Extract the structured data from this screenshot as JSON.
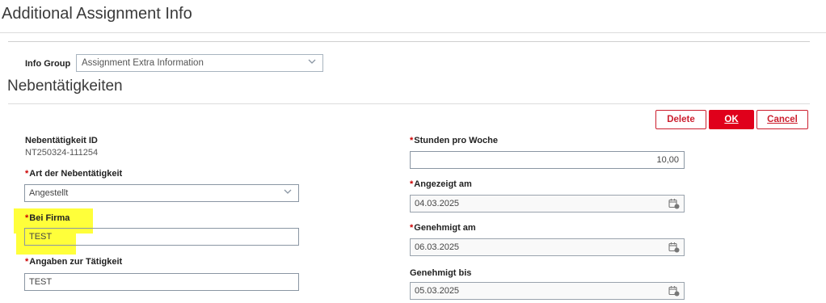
{
  "page": {
    "title": "Additional Assignment Info"
  },
  "info_group": {
    "label": "Info Group",
    "value": "Assignment Extra Information"
  },
  "section": {
    "title": "Nebentätigkeiten"
  },
  "buttons": {
    "delete": "Delete",
    "ok": "OK",
    "cancel": "Cancel"
  },
  "left": {
    "id_label": "Nebentätigkeit ID",
    "id_value": "NT250324-111254",
    "art_label": "Art der Nebentätigkeit",
    "art_value": "Angestellt",
    "firma_label": "Bei Firma",
    "firma_value": "TEST",
    "angaben_label": "Angaben zur Tätigkeit",
    "angaben_value": "TEST"
  },
  "right": {
    "stunden_label": "Stunden pro Woche",
    "stunden_value": "10,00",
    "angezeigt_label": "Angezeigt am",
    "angezeigt_value": "04.03.2025",
    "genehmigt_label": "Genehmigt am",
    "genehmigt_value": "06.03.2025",
    "bis_label": "Genehmigt bis",
    "bis_value": "05.03.2025"
  },
  "required_marker": "*",
  "colors": {
    "accent": "#e0001b",
    "highlight": "#ffff3a"
  },
  "icons": {
    "calendar": "calendar-icon",
    "dropdown": "chevron-down-icon"
  }
}
